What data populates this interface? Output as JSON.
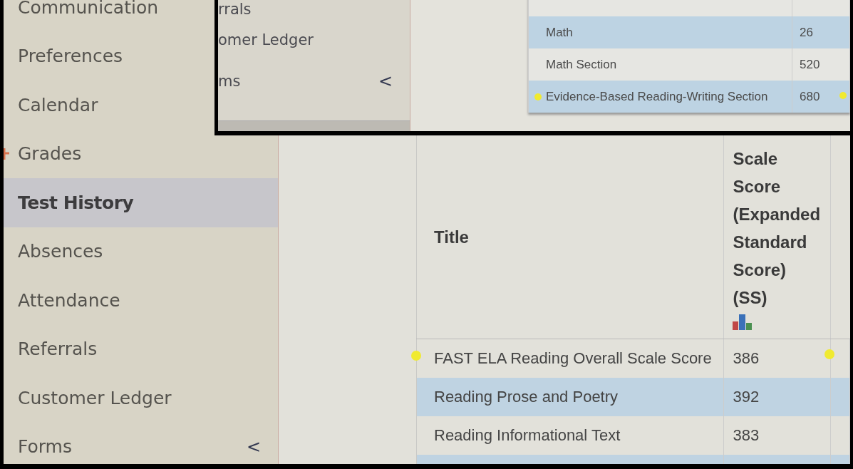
{
  "sidebar": {
    "items": [
      {
        "label": "Communication",
        "selected": false,
        "marked": false
      },
      {
        "label": "Preferences",
        "selected": false,
        "marked": false
      },
      {
        "label": "Calendar",
        "selected": false,
        "marked": false
      },
      {
        "label": "Grades",
        "selected": false,
        "marked": true
      },
      {
        "label": "Test History",
        "selected": true,
        "marked": false
      },
      {
        "label": "Absences",
        "selected": false,
        "marked": false
      },
      {
        "label": "Attendance",
        "selected": false,
        "marked": false
      },
      {
        "label": "Referrals",
        "selected": false,
        "marked": false
      },
      {
        "label": "Customer Ledger",
        "selected": false,
        "marked": false
      },
      {
        "label": "Forms",
        "selected": false,
        "marked": false,
        "chevron": "<"
      }
    ]
  },
  "table": {
    "columns": [
      "Title",
      "Scale Score (Expanded Standard Score) (SS)"
    ],
    "rows": [
      {
        "title": "FAST ELA Reading Overall Scale Score",
        "score": "386",
        "highlighted": true
      },
      {
        "title": "Reading Prose and Poetry",
        "score": "392",
        "highlighted": false
      },
      {
        "title": "Reading Informational Text",
        "score": "383",
        "highlighted": false
      }
    ]
  },
  "inset": {
    "sidebar_items": [
      {
        "label": "rrals"
      },
      {
        "label": "omer Ledger"
      },
      {
        "label": "ms",
        "chevron": "<"
      }
    ],
    "rows": [
      {
        "title": "Math",
        "score": "26",
        "highlighted": false
      },
      {
        "title": "Math Section",
        "score": "520",
        "highlighted": false
      },
      {
        "title": "Evidence-Based Reading-Writing Section",
        "score": "680",
        "highlighted": true
      }
    ]
  }
}
